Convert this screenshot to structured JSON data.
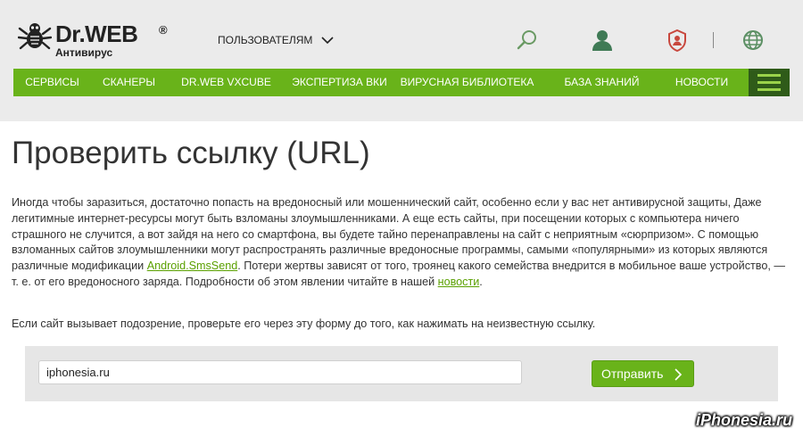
{
  "header": {
    "logo_brand": "Dr.WEB",
    "logo_reg": "®",
    "logo_sub": "Антивирус",
    "users_label": "ПОЛЬЗОВАТЕЛЯМ",
    "icons": [
      "search-icon",
      "user-icon",
      "shield-icon",
      "globe-icon"
    ]
  },
  "nav": {
    "items": [
      "СЕРВИСЫ",
      "СКАНЕРЫ",
      "DR.WEB VXCUBE",
      "ЭКСПЕРТИЗА ВКИ",
      "ВИРУСНАЯ БИБЛИОТЕКА",
      "БАЗА ЗНАНИЙ",
      "НОВОСТИ"
    ]
  },
  "page": {
    "title": "Проверить ссылку (URL)",
    "intro_part1": "Иногда чтобы заразиться, достаточно попасть на вредоносный или мошеннический сайт, особенно если у вас нет антивирусной защиты, Даже легитимные интернет-ресурсы могут быть взломаны злоумышленниками. А еще есть сайты, при посещении которых с компьютера ничего страшного не случится, а вот зайдя на него со смартфона, вы будете тайно перенаправлены на сайт с неприятным «сюрпризом». С помощью взломанных сайтов злоумышленники могут распространять различные вредоносные программы, самыми «популярными» из которых являются различные модификации ",
    "intro_link1": "Android.SmsSend",
    "intro_part2": ". Потери жертвы зависят от того, троянец какого семейства внедрится в мобильное ваше устройство, — т. е. от его вредоносного заряда. Подробности об этом явлении читайте в нашей ",
    "intro_link2": "новости",
    "intro_part3": ".",
    "prompt": "Если сайт вызывает подозрение, проверьте его через эту форму до того, как нажимать на неизвестную ссылку."
  },
  "form": {
    "url_value": "iphonesia.ru",
    "submit_label": "Отправить"
  },
  "watermark": "iPhonesia.ru",
  "colors": {
    "accent_green": "#69b31a",
    "menu_dark": "#2f5b19",
    "link_green": "#5aa000"
  }
}
